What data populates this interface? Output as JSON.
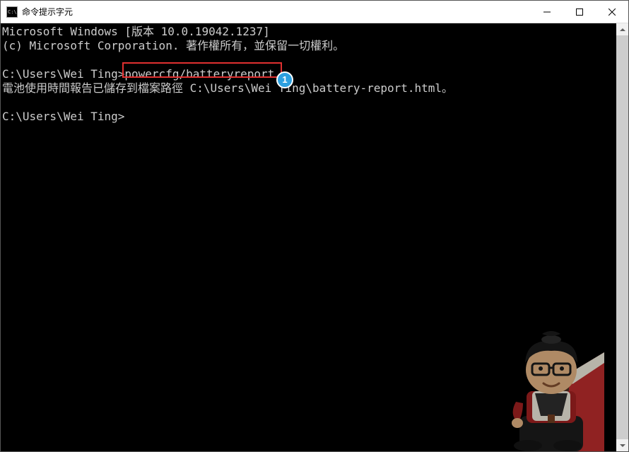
{
  "window": {
    "title": "命令提示字元",
    "icon_label": "C:\\"
  },
  "terminal": {
    "line1": "Microsoft Windows [版本 10.0.19042.1237]",
    "line2": "(c) Microsoft Corporation. 著作權所有，並保留一切權利。",
    "line3": "",
    "line4_prompt": "C:\\Users\\Wei Ting>",
    "line4_cmd": "powercfg/batteryreport",
    "line5": "電池使用時間報告已儲存到檔案路徑 C:\\Users\\Wei Ting\\battery-report.html。",
    "line6": "",
    "line7": "C:\\Users\\Wei Ting>"
  },
  "callout": {
    "number": "1"
  }
}
